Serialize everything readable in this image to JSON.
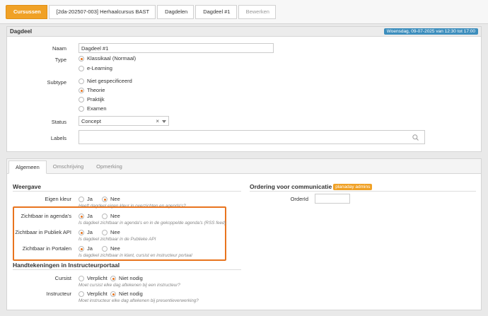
{
  "breadcrumb": {
    "items": [
      "Cursussen",
      "[2da-202507-003] Herhaalcursus BAST",
      "Dagdelen",
      "Dagdeel #1",
      "Bewerken"
    ]
  },
  "dagdeel_panel": {
    "title": "Dagdeel",
    "date_badge": "Woensdag, 09-07-2025 van 12:30 tot 17:00",
    "naam_label": "Naam",
    "naam_value": "Dagdeel #1",
    "type_label": "Type",
    "type_options": [
      "Klassikaal (Normaal)",
      "e-Learning"
    ],
    "type_selected": 0,
    "subtype_label": "Subtype",
    "subtype_options": [
      "Niet gespecificeerd",
      "Theorie",
      "Praktijk",
      "Examen"
    ],
    "subtype_selected": 1,
    "status_label": "Status",
    "status_value": "Concept",
    "status_clear": "×",
    "labels_label": "Labels"
  },
  "tabs": [
    "Algemeen",
    "Omschrijving",
    "Opmerking"
  ],
  "weergave": {
    "title": "Weergave",
    "rows": [
      {
        "label": "Eigen kleur",
        "options": [
          "Ja",
          "Nee"
        ],
        "selected": 1,
        "hint": "Heeft dagdeel eigen kleur in overzichten en agenda's?"
      },
      {
        "label": "Zichtbaar in agenda's",
        "options": [
          "Ja",
          "Nee"
        ],
        "selected": 0,
        "hint": "Is dagdeel zichtbaar in agenda's en in de gekoppelde agenda's (RSS feed)"
      },
      {
        "label": "Zichtbaar in Publiek API",
        "options": [
          "Ja",
          "Nee"
        ],
        "selected": 0,
        "hint": "Is dagdeel zichtbaar in de Publieke API"
      },
      {
        "label": "Zichtbaar in Portalen",
        "options": [
          "Ja",
          "Nee"
        ],
        "selected": 0,
        "hint": "Is dagdeel zichtbaar in klant, cursist en instructeur portaal"
      }
    ]
  },
  "handtekeningen": {
    "title": "Handtekeningen in Instructeurportaal",
    "rows": [
      {
        "label": "Cursist",
        "options": [
          "Verplicht",
          "Niet nodig"
        ],
        "selected": 1,
        "hint": "Moet cursist elke dag aftekenen bij een instructeur?"
      },
      {
        "label": "Instructeur",
        "options": [
          "Verplicht",
          "Niet nodig"
        ],
        "selected": 1,
        "hint": "Moet instructeur elke dag aftekenen bij presentieverwerking?"
      }
    ]
  },
  "ordering": {
    "title": "Ordering voor communicatie",
    "badge": "planaday admins",
    "orderid_label": "OrderId",
    "orderid_value": ""
  },
  "colors": {
    "accent": "#f0a126",
    "radio": "#e8741e",
    "badge_blue": "#3d8ebd"
  },
  "icons": {
    "search": "search-icon",
    "dropdown": "chevron-down-icon"
  }
}
